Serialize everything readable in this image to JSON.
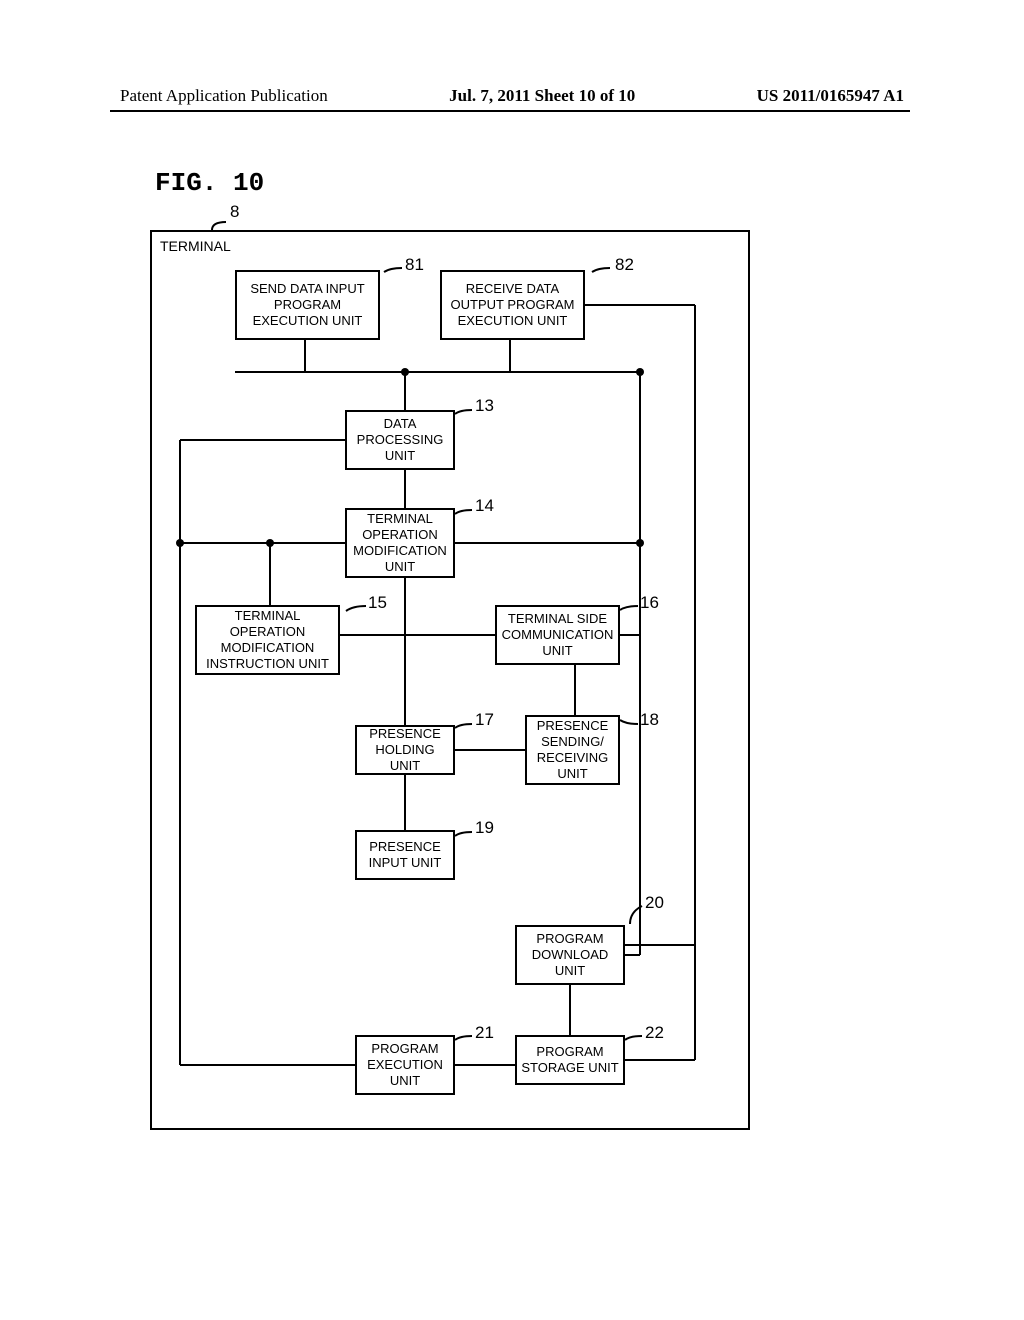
{
  "header": {
    "left": "Patent Application Publication",
    "center": "Jul. 7, 2011  Sheet 10 of 10",
    "right": "US 2011/0165947 A1"
  },
  "figure_label": "FIG. 10",
  "outer_label": "TERMINAL",
  "ref_outer": "8",
  "blocks": {
    "b81": {
      "label": "SEND DATA INPUT\nPROGRAM\nEXECUTION UNIT",
      "ref": "81"
    },
    "b82": {
      "label": "RECEIVE DATA\nOUTPUT PROGRAM\nEXECUTION UNIT",
      "ref": "82"
    },
    "b13": {
      "label": "DATA\nPROCESSING\nUNIT",
      "ref": "13"
    },
    "b14": {
      "label": "TERMINAL\nOPERATION\nMODIFICATION\nUNIT",
      "ref": "14"
    },
    "b15": {
      "label": "TERMINAL\nOPERATION\nMODIFICATION\nINSTRUCTION UNIT",
      "ref": "15"
    },
    "b16": {
      "label": "TERMINAL SIDE\nCOMMUNICATION\nUNIT",
      "ref": "16"
    },
    "b17": {
      "label": "PRESENCE\nHOLDING UNIT",
      "ref": "17"
    },
    "b18": {
      "label": "PRESENCE\nSENDING/\nRECEIVING\nUNIT",
      "ref": "18"
    },
    "b19": {
      "label": "PRESENCE\nINPUT UNIT",
      "ref": "19"
    },
    "b20": {
      "label": "PROGRAM\nDOWNLOAD\nUNIT",
      "ref": "20"
    },
    "b21": {
      "label": "PROGRAM\nEXECUTION\nUNIT",
      "ref": "21"
    },
    "b22": {
      "label": "PROGRAM\nSTORAGE UNIT",
      "ref": "22"
    }
  }
}
